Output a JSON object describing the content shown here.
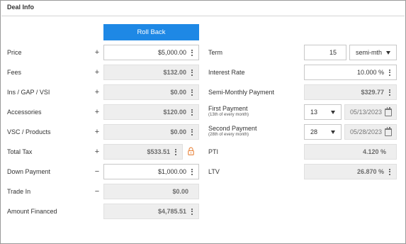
{
  "panel": {
    "title": "Deal Info"
  },
  "actions": {
    "roll_back_label": "Roll Back"
  },
  "left": {
    "price": {
      "label": "Price",
      "sign": "+",
      "value": "$5,000.00"
    },
    "fees": {
      "label": "Fees",
      "sign": "+",
      "value": "$132.00"
    },
    "ins_gap_vsi": {
      "label": "Ins / GAP / VSI",
      "sign": "+",
      "value": "$0.00"
    },
    "accessories": {
      "label": "Accessories",
      "sign": "+",
      "value": "$120.00"
    },
    "vsc_products": {
      "label": "VSC / Products",
      "sign": "+",
      "value": "$0.00"
    },
    "total_tax": {
      "label": "Total Tax",
      "sign": "+",
      "value": "$533.51"
    },
    "down_payment": {
      "label": "Down Payment",
      "sign": "−",
      "value": "$1,000.00"
    },
    "trade_in": {
      "label": "Trade In",
      "sign": "−",
      "value": "$0.00"
    },
    "amount_financed": {
      "label": "Amount Financed",
      "value": "$4,785.51"
    }
  },
  "right": {
    "term": {
      "label": "Term",
      "value": "15",
      "frequency": "semi-mth"
    },
    "interest_rate": {
      "label": "Interest Rate",
      "value": "10.000 %"
    },
    "semi_monthly_payment": {
      "label": "Semi-Monthly Payment",
      "value": "$329.77"
    },
    "first_payment": {
      "label": "First Payment",
      "sublabel": "(13th of every month)",
      "day": "13",
      "date": "05/13/2023"
    },
    "second_payment": {
      "label": "Second Payment",
      "sublabel": "(28th of every month)",
      "day": "28",
      "date": "05/28/2023"
    },
    "pti": {
      "label": "PTI",
      "value": "4.120 %"
    },
    "ltv": {
      "label": "LTV",
      "value": "26.870 %"
    }
  },
  "icons": {
    "kebab": "more-vertical-icon",
    "lock": "lock-icon",
    "calendar": "calendar-icon",
    "dropdown": "chevron-down-icon"
  },
  "colors": {
    "accent": "#1e88e5",
    "lock": "#e8833a",
    "readonly_bg": "#eeeeee"
  }
}
